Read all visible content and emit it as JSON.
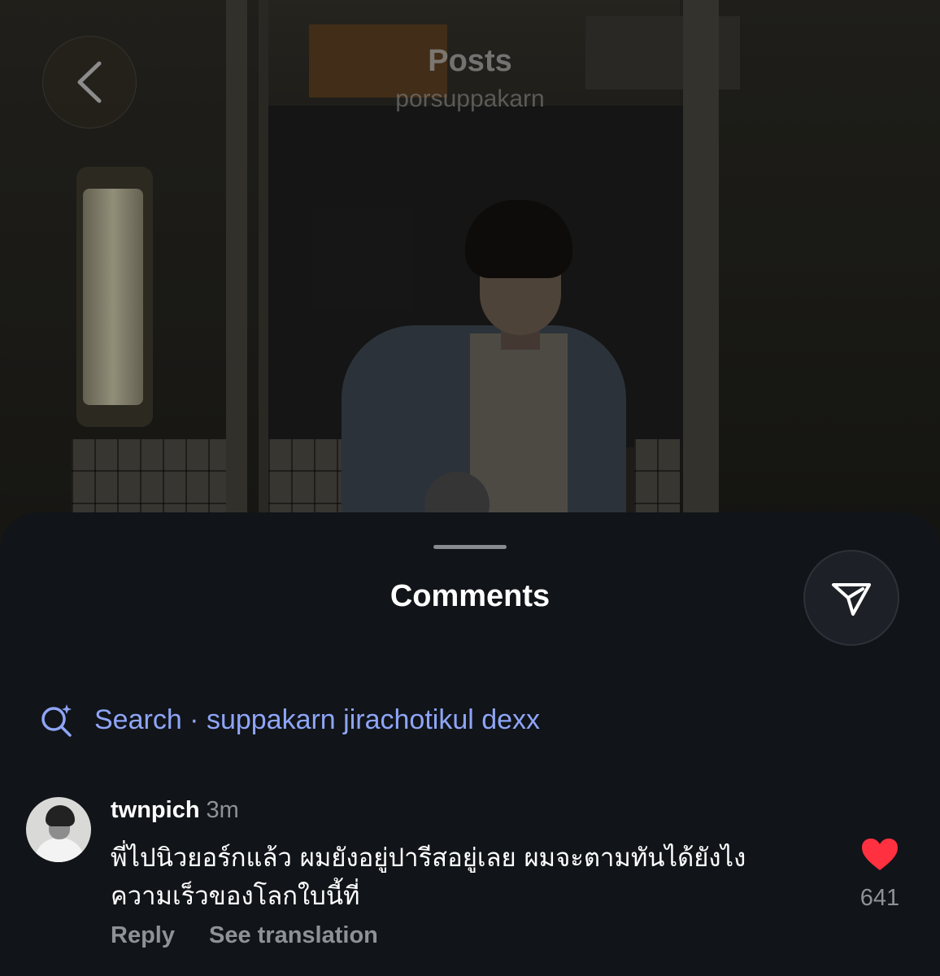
{
  "header": {
    "title": "Posts",
    "username": "porsuppakarn"
  },
  "sheet": {
    "title": "Comments"
  },
  "search": {
    "text": "Search · suppakarn jirachotikul dexx"
  },
  "comment": {
    "username": "twnpich",
    "time": "3m",
    "text": "พี่ไปนิวยอร์กแล้ว ผมยังอยู่ปารีสอยู่เลย ผมจะตามทันได้ยังไงความเร็วของโลกใบนี้ที่",
    "reply_label": "Reply",
    "translate_label": "See translation",
    "like_count": "641"
  },
  "icons": {
    "back": "chevron-left-icon",
    "share": "send-icon",
    "search": "ai-search-icon",
    "like": "heart-icon"
  },
  "colors": {
    "sheet_background": "#111418",
    "search_accent": "#8ea5f7",
    "like_red": "#ff3040",
    "muted_text": "#8e9297"
  }
}
